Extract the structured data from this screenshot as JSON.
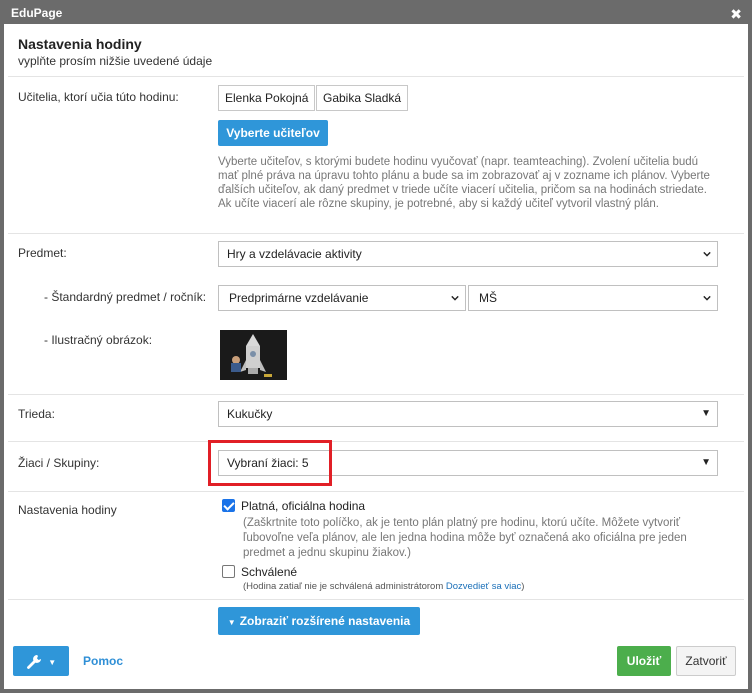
{
  "window": {
    "title": "EduPage",
    "close_symbol": "✖"
  },
  "header": {
    "title": "Nastavenia hodiny",
    "subtitle": "vyplňte prosím nižšie uvedené údaje"
  },
  "teachers": {
    "label": "Učitelia, ktorí učia túto hodinu:",
    "chips": [
      "Elenka Pokojná",
      "Gabika Sladká"
    ],
    "select_button": "Vyberte učiteľov",
    "help": "Vyberte učiteľov, s ktorými budete hodinu vyučovať (napr. teamteaching). Zvolení učitelia budú mať plné práva na úpravu tohto plánu a bude sa im zobrazovať aj v zozname ich plánov. Vyberte ďalších učiteľov, ak daný predmet v triede učíte viacerí učitelia, pričom sa na hodinách striedate. Ak učíte viacerí ale rôzne skupiny, je potrebné, aby si každý učiteľ vytvoril vlastný plán."
  },
  "subject": {
    "label": "Predmet:",
    "value": "Hry a vzdelávacie aktivity",
    "standard_label": "- Štandardný predmet / ročník:",
    "standard_value": "Predprimárne vzdelávanie",
    "grade_value": "MŠ",
    "image_label": "- Ilustračný obrázok:"
  },
  "class": {
    "label": "Trieda:",
    "value": "Kukučky"
  },
  "students": {
    "label": "Žiaci / Skupiny:",
    "value": "Vybraní žiaci: 5"
  },
  "lesson_settings": {
    "label": "Nastavenia hodiny",
    "official": {
      "label": "Platná, oficiálna hodina",
      "checked": true,
      "note": "(Zaškrtnite toto políčko, ak je tento plán platný pre hodinu, ktorú učíte. Môžete vytvoriť ľubovoľne veľa plánov, ale len jedna hodina môže byť označená ako oficiálna pre jeden predmet a jednu skupinu žiakov.)"
    },
    "approved": {
      "label": "Schválené",
      "checked": false,
      "note": "(Hodina zatiaľ nie je schválená administrátorom",
      "link": "Dozvedieť sa viac",
      "note_end": ")"
    }
  },
  "advanced_button": "Zobraziť rozšírené nastavenia",
  "footer": {
    "tools_icon": "wrench-icon",
    "help": "Pomoc",
    "save": "Uložiť",
    "close": "Zatvoriť"
  },
  "colors": {
    "titlebar": "#6b6b6b",
    "primary_blue": "#2f96d9",
    "save_green": "#4cae4c",
    "highlight_red": "#e11f26",
    "link_blue": "#1a6fb8"
  }
}
